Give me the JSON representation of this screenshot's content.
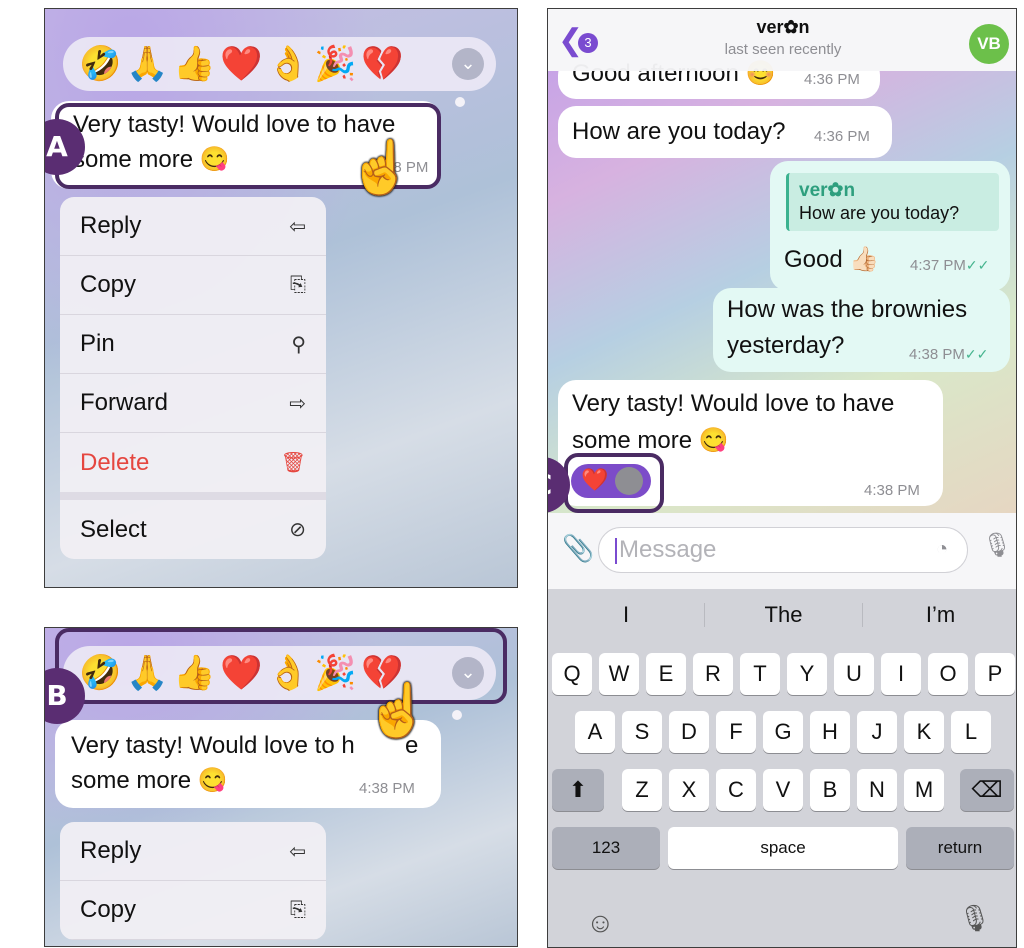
{
  "reactions": [
    "🤣",
    "🙏",
    "👍",
    "❤️",
    "👌",
    "🎉",
    "💔"
  ],
  "message": {
    "line1": "Very tasty! Would love to have",
    "line2": "some more 😋",
    "time": "4:38 PM"
  },
  "panel_a": {
    "line1": "Very tasty! Would love to have",
    "line2": "some more 😋",
    "time_partial": "38 PM"
  },
  "panel_b": {
    "line1": "Very tasty! Would love to h",
    "line1_tail": "e",
    "line2": "some more 😋",
    "time": "4:38 PM"
  },
  "menu": {
    "items": [
      {
        "label": "Reply",
        "icon": "reply-icon",
        "glyph": "⇦"
      },
      {
        "label": "Copy",
        "icon": "copy-icon",
        "glyph": "⎘"
      },
      {
        "label": "Pin",
        "icon": "pin-icon",
        "glyph": "⚲"
      },
      {
        "label": "Forward",
        "icon": "forward-icon",
        "glyph": "⇨"
      },
      {
        "label": "Delete",
        "icon": "trash-icon",
        "glyph": "🗑"
      },
      {
        "label": "Select",
        "icon": "select-circle-icon",
        "glyph": "⊘"
      }
    ],
    "danger_color": "#e5463f"
  },
  "callouts": {
    "a": "A",
    "b": "B",
    "c": "C"
  },
  "chat": {
    "back_badge": "3",
    "contact_name": "ver✿n",
    "status": "last seen recently",
    "avatar": "VB",
    "accent": "#7a4bd0",
    "messages": [
      {
        "text": "Good afternoon 😊",
        "time": "4:36 PM"
      },
      {
        "text": "How are you today?",
        "time": "4:36 PM"
      },
      {
        "reply_name": "ver✿n",
        "reply_text": "How are you today?",
        "text": "Good 👍🏻",
        "time": "4:37 PM"
      },
      {
        "line1": "How was the brownies",
        "line2": "yesterday?",
        "time": "4:38 PM"
      },
      {
        "line1": "Very tasty! Would love to have",
        "line2": "some more 😋",
        "time": "4:38 PM"
      }
    ],
    "checkmarks": "✓✓",
    "input_placeholder": "Message"
  },
  "keyboard": {
    "suggestions": [
      "I",
      "The",
      "I’m"
    ],
    "row1": [
      "Q",
      "W",
      "E",
      "R",
      "T",
      "Y",
      "U",
      "I",
      "O",
      "P"
    ],
    "row2": [
      "A",
      "S",
      "D",
      "F",
      "G",
      "H",
      "J",
      "K",
      "L"
    ],
    "row3": [
      "Z",
      "X",
      "C",
      "V",
      "B",
      "N",
      "M"
    ],
    "numbers": "123",
    "space": "space",
    "return": "return"
  }
}
